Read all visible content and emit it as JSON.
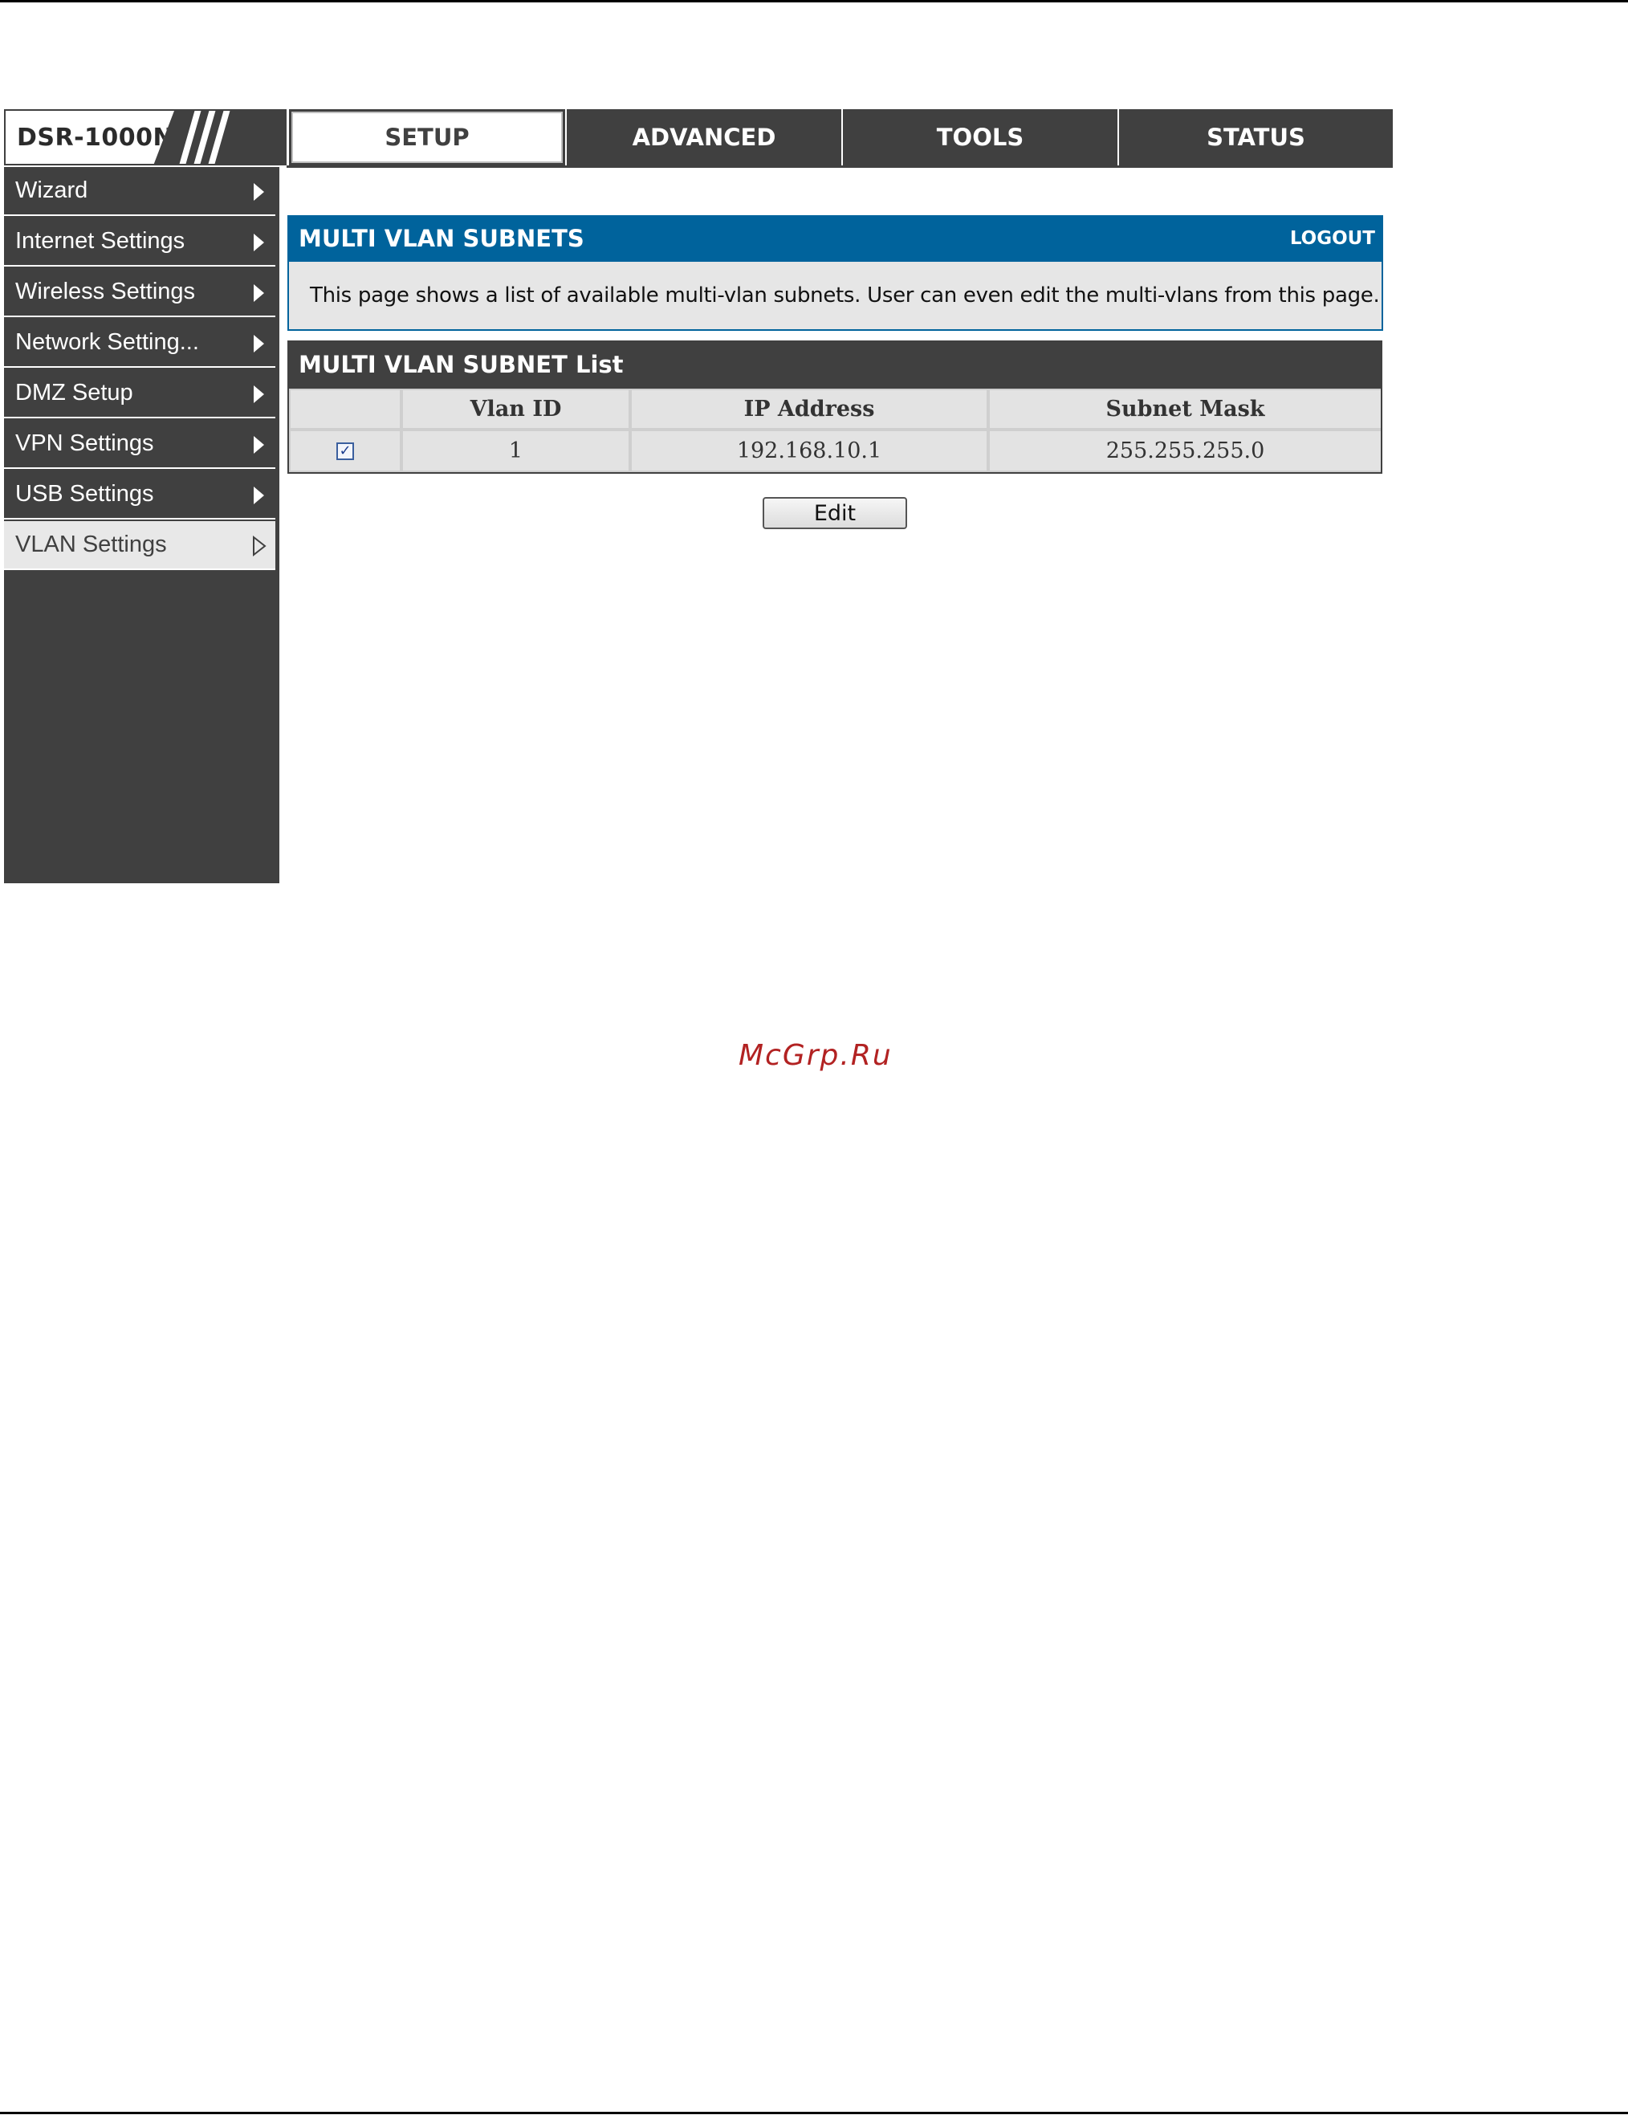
{
  "header": {
    "logo": "DSR-1000N",
    "tabs": [
      {
        "label": "SETUP",
        "active": true
      },
      {
        "label": "ADVANCED",
        "active": false
      },
      {
        "label": "TOOLS",
        "active": false
      },
      {
        "label": "STATUS",
        "active": false
      }
    ]
  },
  "sidebar": {
    "items": [
      {
        "label": "Wizard",
        "active": false
      },
      {
        "label": "Internet Settings",
        "active": false
      },
      {
        "label": "Wireless Settings",
        "active": false
      },
      {
        "label": "Network Setting...",
        "active": false
      },
      {
        "label": "DMZ Setup",
        "active": false
      },
      {
        "label": "VPN Settings",
        "active": false
      },
      {
        "label": "USB Settings",
        "active": false
      },
      {
        "label": "VLAN Settings",
        "active": true
      }
    ]
  },
  "panel": {
    "title": "MULTI VLAN SUBNETS",
    "logout": "LOGOUT",
    "description": "This page shows a list of available multi-vlan subnets. User can even edit the multi-vlans from this page."
  },
  "list": {
    "title": "MULTI VLAN SUBNET List",
    "columns": [
      "",
      "Vlan ID",
      "IP Address",
      "Subnet Mask"
    ],
    "rows": [
      {
        "checked": true,
        "checkmark": "✓",
        "vlan_id": "1",
        "ip_address": "192.168.10.1",
        "subnet_mask": "255.255.255.0"
      }
    ]
  },
  "actions": {
    "edit_label": "Edit"
  },
  "watermark": "McGrp.Ru",
  "colors": {
    "header_dark": "#404040",
    "panel_blue": "#00639c",
    "row_bg": "#e3e3e3",
    "watermark": "#b22222"
  }
}
